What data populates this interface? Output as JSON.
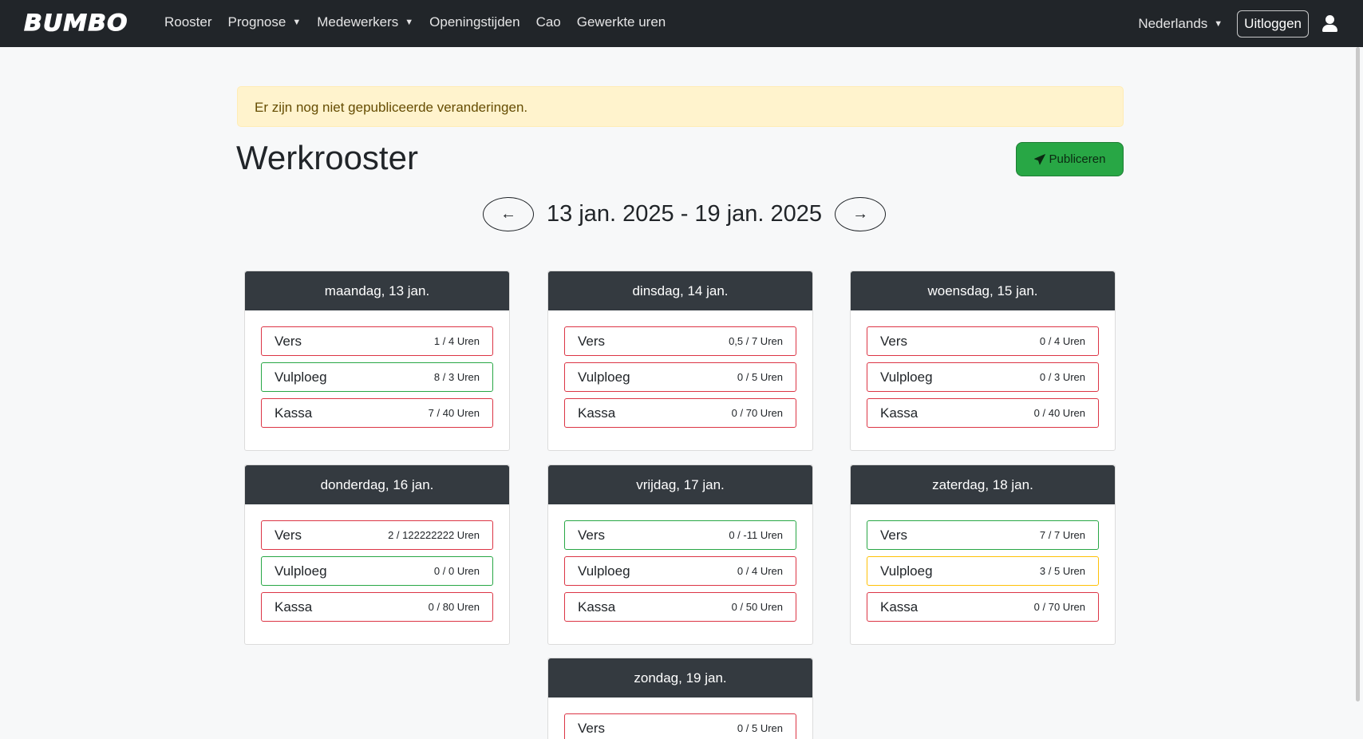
{
  "nav": {
    "logo": "BUMBO",
    "links": [
      {
        "label": "Rooster",
        "dropdown": false
      },
      {
        "label": "Prognose",
        "dropdown": true
      },
      {
        "label": "Medewerkers",
        "dropdown": true
      },
      {
        "label": "Openingstijden",
        "dropdown": false
      },
      {
        "label": "Cao",
        "dropdown": false
      },
      {
        "label": "Gewerkte uren",
        "dropdown": false
      }
    ],
    "caret": "▼",
    "language": "Nederlands",
    "logout": "Uitloggen"
  },
  "alert": {
    "text": "Er zijn nog niet gepubliceerde veranderingen."
  },
  "page": {
    "title": "Werkrooster",
    "publish_label": "Publiceren"
  },
  "week": {
    "prev": "←",
    "label": "13 jan. 2025 - 19 jan. 2025",
    "next": "→"
  },
  "status_colors": {
    "red": "#dc3545",
    "green": "#28a745",
    "yellow": "#ffc107"
  },
  "days": [
    {
      "title": "maandag, 13 jan.",
      "departments": [
        {
          "name": "Vers",
          "hours": "1 / 4 Uren",
          "status": "red"
        },
        {
          "name": "Vulploeg",
          "hours": "8 / 3 Uren",
          "status": "green"
        },
        {
          "name": "Kassa",
          "hours": "7 / 40 Uren",
          "status": "red"
        }
      ]
    },
    {
      "title": "dinsdag, 14 jan.",
      "departments": [
        {
          "name": "Vers",
          "hours": "0,5 / 7 Uren",
          "status": "red"
        },
        {
          "name": "Vulploeg",
          "hours": "0 / 5 Uren",
          "status": "red"
        },
        {
          "name": "Kassa",
          "hours": "0 / 70 Uren",
          "status": "red"
        }
      ]
    },
    {
      "title": "woensdag, 15 jan.",
      "departments": [
        {
          "name": "Vers",
          "hours": "0 / 4 Uren",
          "status": "red"
        },
        {
          "name": "Vulploeg",
          "hours": "0 / 3 Uren",
          "status": "red"
        },
        {
          "name": "Kassa",
          "hours": "0 / 40 Uren",
          "status": "red"
        }
      ]
    },
    {
      "title": "donderdag, 16 jan.",
      "departments": [
        {
          "name": "Vers",
          "hours": "2 / 122222222 Uren",
          "status": "red"
        },
        {
          "name": "Vulploeg",
          "hours": "0 / 0 Uren",
          "status": "green"
        },
        {
          "name": "Kassa",
          "hours": "0 / 80 Uren",
          "status": "red"
        }
      ]
    },
    {
      "title": "vrijdag, 17 jan.",
      "departments": [
        {
          "name": "Vers",
          "hours": "0 / -11 Uren",
          "status": "green"
        },
        {
          "name": "Vulploeg",
          "hours": "0 / 4 Uren",
          "status": "red"
        },
        {
          "name": "Kassa",
          "hours": "0 / 50 Uren",
          "status": "red"
        }
      ]
    },
    {
      "title": "zaterdag, 18 jan.",
      "departments": [
        {
          "name": "Vers",
          "hours": "7 / 7 Uren",
          "status": "green"
        },
        {
          "name": "Vulploeg",
          "hours": "3 / 5 Uren",
          "status": "yellow"
        },
        {
          "name": "Kassa",
          "hours": "0 / 70 Uren",
          "status": "red"
        }
      ]
    },
    {
      "title": "zondag, 19 jan.",
      "departments": [
        {
          "name": "Vers",
          "hours": "0 / 5 Uren",
          "status": "red"
        }
      ]
    }
  ]
}
